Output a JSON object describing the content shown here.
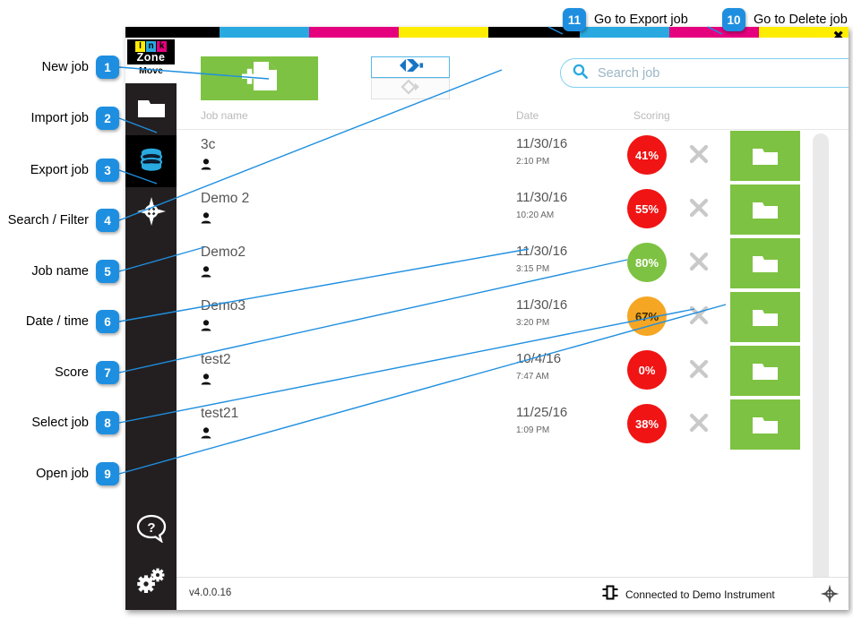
{
  "window": {
    "close_label": "✖",
    "cmyk_segments": [
      "#000000",
      "#29a9e0",
      "#e5007e",
      "#ffed00",
      "#000000",
      "#29a9e0",
      "#e5007e",
      "#ffed00"
    ]
  },
  "brand": {
    "letters": [
      "I",
      "n",
      "k"
    ],
    "letter_colors": [
      "#ffed00",
      "#29a9e0",
      "#e5007e"
    ],
    "word": "Zone",
    "subtitle": "Move"
  },
  "sidebar": {
    "items": [
      {
        "name": "import-job",
        "icon": "folder-icon",
        "active": false
      },
      {
        "name": "export-job",
        "icon": "database-icon",
        "active": true
      },
      {
        "name": "search-filter",
        "icon": "target-icon",
        "active": false
      },
      {
        "name": "help",
        "icon": "help-bubble-icon",
        "active": false
      },
      {
        "name": "settings",
        "icon": "gears-icon",
        "active": false
      }
    ]
  },
  "toolbar": {
    "new_job": {
      "icon": "new-document-icon",
      "color": "#7dc242"
    },
    "import_job": {
      "icon": "import-arrow-icon",
      "color": "#1775c4",
      "enabled": true
    },
    "export_job": {
      "icon": "export-arrow-icon",
      "color": "#d2d2d2",
      "enabled": false
    }
  },
  "search": {
    "icon": "search-icon",
    "value": "",
    "placeholder": "Search job"
  },
  "table": {
    "columns": [
      "Job name",
      "Date",
      "Scoring"
    ],
    "rows": [
      {
        "name": "3c",
        "date": "11/30/16",
        "time": "2:10 PM",
        "score": "41%",
        "score_color": "#f01414",
        "score_text_color": "#ffffff"
      },
      {
        "name": "Demo 2",
        "date": "11/30/16",
        "time": "10:20 AM",
        "score": "55%",
        "score_color": "#f01414",
        "score_text_color": "#ffffff"
      },
      {
        "name": "Demo2",
        "date": "11/30/16",
        "time": "3:15 PM",
        "score": "80%",
        "score_color": "#7dc242",
        "score_text_color": "#ffffff"
      },
      {
        "name": "Demo3",
        "date": "11/30/16",
        "time": "3:20 PM",
        "score": "67%",
        "score_color": "#f5a623",
        "score_text_color": "#3a2a00"
      },
      {
        "name": "test2",
        "date": "10/4/16",
        "time": "7:47 AM",
        "score": "0%",
        "score_color": "#f01414",
        "score_text_color": "#ffffff"
      },
      {
        "name": "test21",
        "date": "11/25/16",
        "time": "1:09 PM",
        "score": "38%",
        "score_color": "#f01414",
        "score_text_color": "#ffffff"
      }
    ]
  },
  "status_bar": {
    "version": "v4.0.0.16",
    "connection": "Connected to Demo Instrument",
    "connection_icon": "device-plug-icon",
    "target_icon": "target-icon"
  },
  "annotations": {
    "accent_color": "#1e8fe0",
    "left": [
      {
        "num": "1",
        "label": "New job"
      },
      {
        "num": "2",
        "label": "Import job"
      },
      {
        "num": "3",
        "label": "Export job"
      },
      {
        "num": "4",
        "label": "Search / Filter"
      },
      {
        "num": "5",
        "label": "Job name"
      },
      {
        "num": "6",
        "label": "Date / time"
      },
      {
        "num": "7",
        "label": "Score"
      },
      {
        "num": "8",
        "label": "Select job"
      },
      {
        "num": "9",
        "label": "Open job"
      }
    ],
    "top": [
      {
        "num": "11",
        "label": "Go to Export job"
      },
      {
        "num": "10",
        "label": "Go to Delete job"
      }
    ]
  }
}
